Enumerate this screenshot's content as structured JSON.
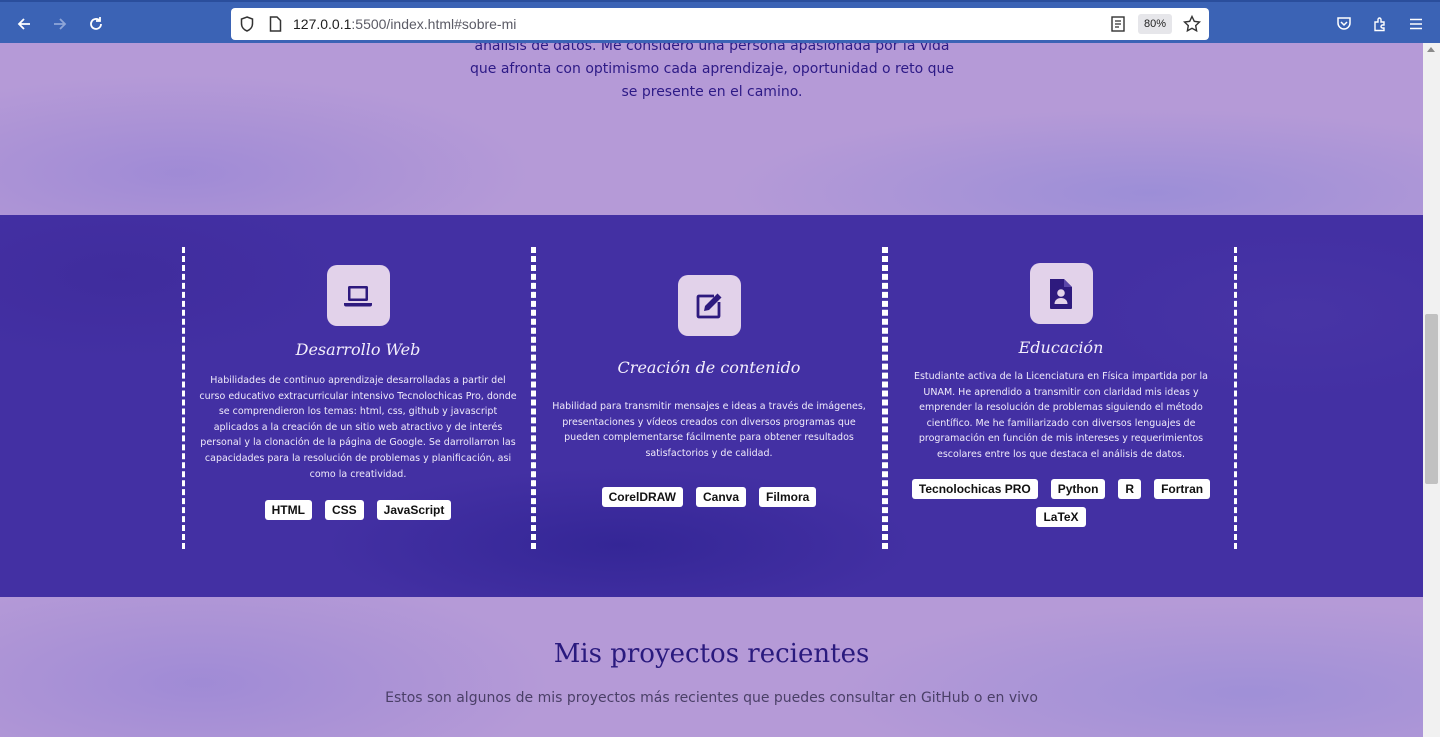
{
  "browser": {
    "url_host": "127.0.0.1",
    "url_path": ":5500/index.html#sobre-mi",
    "zoom": "80%"
  },
  "about": {
    "line1": "análisis de datos. Me considero una persona apasionada por la vida",
    "line2": "que afronta con optimismo cada aprendizaje, oportunidad o reto que",
    "line3": "se presente en el camino."
  },
  "services": [
    {
      "icon": "laptop-icon",
      "title": "Desarrollo Web",
      "description": "Habilidades de continuo aprendizaje desarrolladas a partir del curso educativo extracurricular intensivo Tecnolochicas Pro, donde se comprendieron los temas: html, css, github y javascript aplicados a la creación de un sitio web atractivo y de interés personal y la clonación de la página de Google. Se darrollarron las capacidades para la resolución de problemas y planificación, asi como la creatividad.",
      "tags": [
        "HTML",
        "CSS",
        "JavaScript"
      ]
    },
    {
      "icon": "edit-icon",
      "title": "Creación de contenido",
      "description": "Habilidad para transmitir mensajes e ideas a través de imágenes, presentaciones y vídeos creados con diversos programas que pueden complementarse fácilmente para obtener resultados satisfactorios y de calidad.",
      "tags": [
        "CorelDRAW",
        "Canva",
        "Filmora"
      ]
    },
    {
      "icon": "file-user-icon",
      "title": "Educación",
      "description": "Estudiante activa de la Licenciatura en Física impartida por la UNAM. He aprendido a transmitir con claridad mis ideas y emprender la resolución de problemas siguiendo el método científico. Me he familiarizado con diversos lenguajes de programación en función de mis intereses y requerimientos escolares entre los que destaca el análisis de datos.",
      "tags": [
        "Tecnolochicas PRO",
        "Python",
        "R",
        "Fortran",
        "LaTeX"
      ]
    }
  ],
  "projects": {
    "title": "Mis proyectos recientes",
    "subtitle": "Estos son algunos de mis proyectos más recientes que puedes consultar en GitHub o en vivo"
  }
}
